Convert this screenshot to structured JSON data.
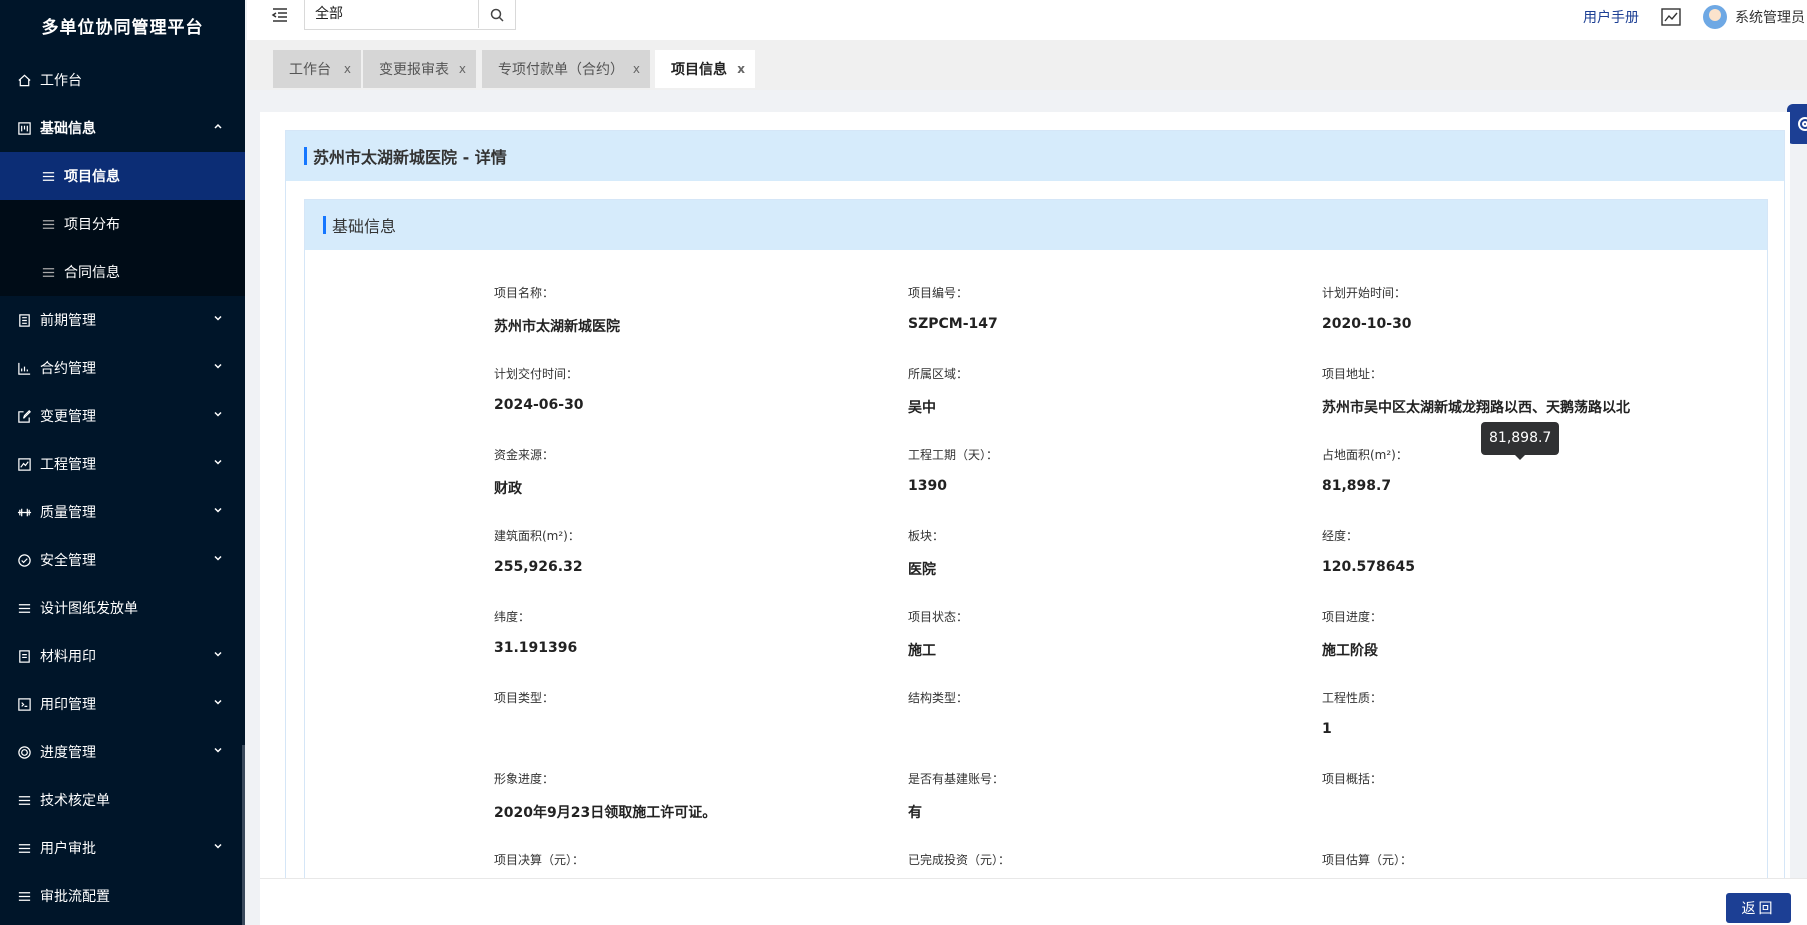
{
  "app": {
    "title": "多单位协同管理平台"
  },
  "sidebar": {
    "items": [
      {
        "label": "工作台"
      },
      {
        "label": "基础信息"
      },
      {
        "label": "项目信息"
      },
      {
        "label": "项目分布"
      },
      {
        "label": "合同信息"
      },
      {
        "label": "前期管理"
      },
      {
        "label": "合约管理"
      },
      {
        "label": "变更管理"
      },
      {
        "label": "工程管理"
      },
      {
        "label": "质量管理"
      },
      {
        "label": "安全管理"
      },
      {
        "label": "设计图纸发放单"
      },
      {
        "label": "材料用印"
      },
      {
        "label": "用印管理"
      },
      {
        "label": "进度管理"
      },
      {
        "label": "技术核定单"
      },
      {
        "label": "用户审批"
      },
      {
        "label": "审批流配置"
      }
    ]
  },
  "header": {
    "search_value": "全部",
    "manual": "用户手册",
    "username": "系统管理员"
  },
  "tabs": [
    {
      "label": "工作台",
      "close": "x"
    },
    {
      "label": "变更报审表",
      "close": "x"
    },
    {
      "label": "专项付款单（合约）",
      "close": "x"
    },
    {
      "label": "项目信息",
      "close": "x"
    }
  ],
  "detail": {
    "title": "苏州市太湖新城医院 - 详情",
    "section_title": "基础信息",
    "fields": [
      {
        "label": "项目名称：",
        "value": "苏州市太湖新城医院"
      },
      {
        "label": "项目编号：",
        "value": "SZPCM-147"
      },
      {
        "label": "计划开始时间：",
        "value": "2020-10-30"
      },
      {
        "label": "计划交付时间：",
        "value": "2024-06-30"
      },
      {
        "label": "所属区域：",
        "value": "吴中"
      },
      {
        "label": "项目地址：",
        "value": "苏州市吴中区太湖新城龙翔路以西、天鹅荡路以北"
      },
      {
        "label": "资金来源：",
        "value": "财政"
      },
      {
        "label": "工程工期（天）：",
        "value": "1390"
      },
      {
        "label": "占地面积(m²)：",
        "value": "81,898.7"
      },
      {
        "label": "建筑面积(m²)：",
        "value": "255,926.32"
      },
      {
        "label": "板块：",
        "value": "医院"
      },
      {
        "label": "经度：",
        "value": "120.578645"
      },
      {
        "label": "纬度：",
        "value": "31.191396"
      },
      {
        "label": "项目状态：",
        "value": "施工"
      },
      {
        "label": "项目进度：",
        "value": "施工阶段"
      },
      {
        "label": "项目类型：",
        "value": ""
      },
      {
        "label": "结构类型：",
        "value": ""
      },
      {
        "label": "工程性质：",
        "value": "1"
      },
      {
        "label": "形象进度：",
        "value": "2020年9月23日领取施工许可证。"
      },
      {
        "label": "是否有基建账号：",
        "value": "有"
      },
      {
        "label": "项目概括：",
        "value": ""
      },
      {
        "label": "项目决算（元）：",
        "value": ""
      },
      {
        "label": "已完成投资（元）：",
        "value": ""
      },
      {
        "label": "项目估算（元）：",
        "value": ""
      }
    ],
    "tooltip": "81,898.7"
  },
  "footer": {
    "back": "返回"
  },
  "colors": {
    "sidebar_bg": "#001529",
    "active_item": "#0c2d75",
    "primary": "#1c3f94",
    "header_bg": "#d6ebfb"
  }
}
